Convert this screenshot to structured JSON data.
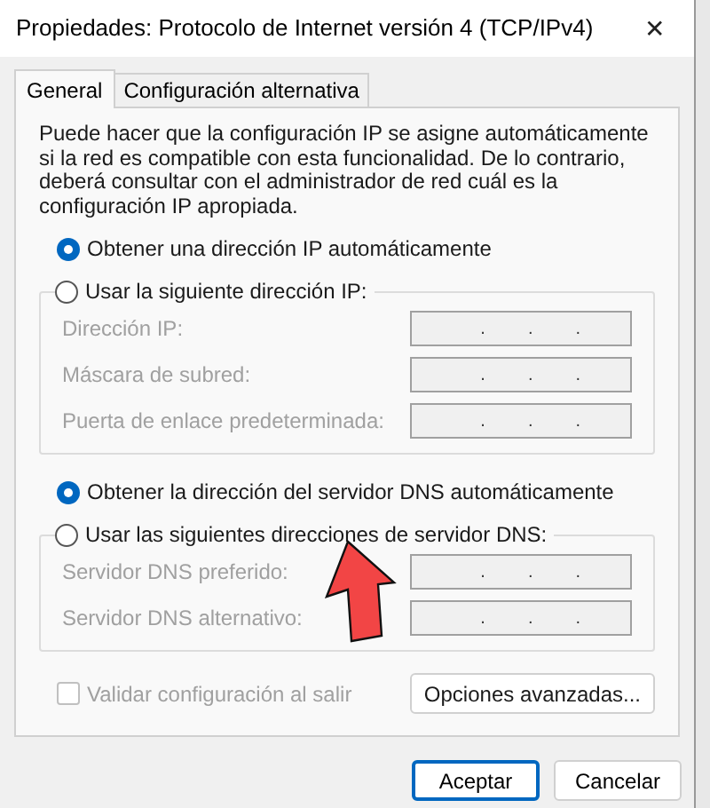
{
  "window": {
    "title": "Propiedades: Protocolo de Internet versión 4 (TCP/IPv4)",
    "close": "✕"
  },
  "tabs": [
    {
      "label": "General",
      "selected": true
    },
    {
      "label": "Configuración alternativa",
      "selected": false
    }
  ],
  "description": "Puede hacer que la configuración IP se asigne automáticamente si la red es compatible con esta funcionalidad. De lo contrario, deberá consultar con el administrador de red cuál es la configuración IP apropiada.",
  "ip_group": {
    "auto": {
      "label": "Obtener una dirección IP automáticamente",
      "selected": true
    },
    "manual": {
      "label": "Usar la siguiente dirección IP:",
      "selected": false
    },
    "fields": [
      {
        "label": "Dirección IP:",
        "disabled": true,
        "separators": [
          ".",
          ".",
          "."
        ]
      },
      {
        "label": "Máscara de subred:",
        "disabled": true,
        "separators": [
          ".",
          ".",
          "."
        ]
      },
      {
        "label": "Puerta de enlace predeterminada:",
        "disabled": true,
        "separators": [
          ".",
          ".",
          "."
        ]
      }
    ]
  },
  "dns_group": {
    "auto": {
      "label": "Obtener la dirección del servidor DNS automáticamente",
      "selected": true
    },
    "manual": {
      "label": "Usar las siguientes direcciones de servidor DNS:",
      "selected": false
    },
    "fields": [
      {
        "label": "Servidor DNS preferido:",
        "disabled": true,
        "separators": [
          ".",
          ".",
          "."
        ]
      },
      {
        "label": "Servidor DNS alternativo:",
        "disabled": true,
        "separators": [
          ".",
          ".",
          "."
        ]
      }
    ]
  },
  "validate": {
    "label": "Validar configuración al salir",
    "checked": false,
    "disabled": true
  },
  "advanced_button": "Opciones avanzadas...",
  "buttons": [
    {
      "label": "Aceptar",
      "default": true
    },
    {
      "label": "Cancelar",
      "default": false
    }
  ]
}
